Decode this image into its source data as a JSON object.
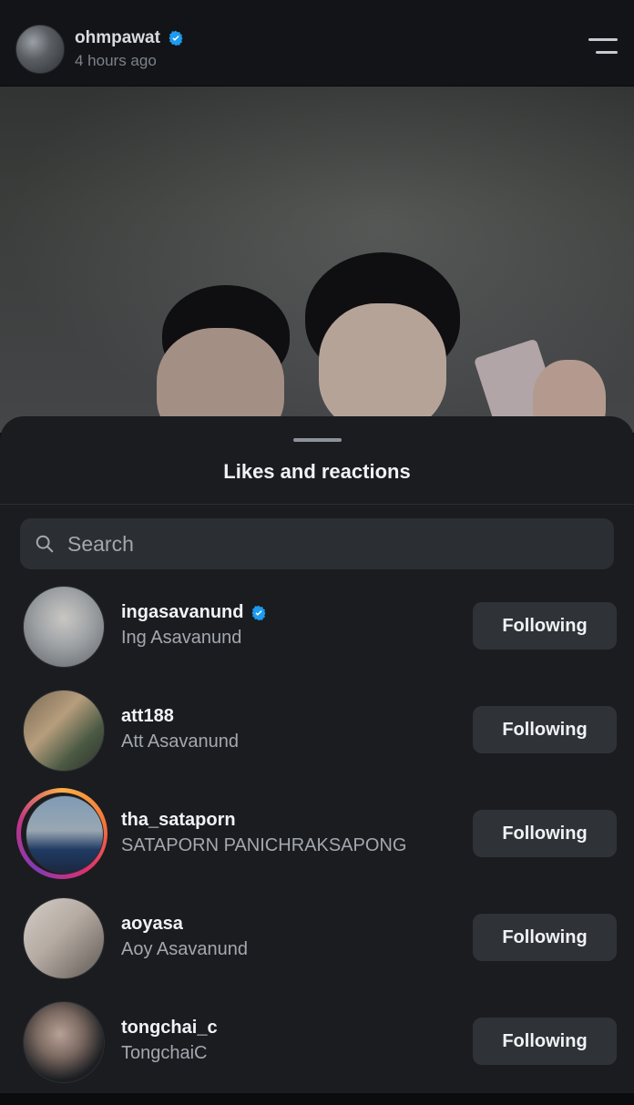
{
  "header": {
    "username": "ohmpawat",
    "time": "4 hours ago"
  },
  "sheet": {
    "title": "Likes and reactions",
    "search_placeholder": "Search"
  },
  "users": [
    {
      "username": "ingasavanund",
      "name": "Ing Asavanund",
      "verified": true,
      "story_ring": false,
      "button": "Following"
    },
    {
      "username": "att188",
      "name": "Att Asavanund",
      "verified": false,
      "story_ring": false,
      "button": "Following"
    },
    {
      "username": "tha_sataporn",
      "name": "SATAPORN PANICHRAKSAPONG",
      "verified": false,
      "story_ring": true,
      "button": "Following"
    },
    {
      "username": "aoyasa",
      "name": "Aoy Asavanund",
      "verified": false,
      "story_ring": false,
      "button": "Following"
    },
    {
      "username": "tongchai_c",
      "name": "TongchaiC",
      "verified": false,
      "story_ring": false,
      "button": "Following"
    }
  ],
  "colors": {
    "verified": "#1d9bf0",
    "button_bg": "#2f3237",
    "sheet_bg": "#1a1c20"
  },
  "icons": {
    "header_menu": "menu-icon",
    "search": "search-icon",
    "verified": "verified-badge-icon"
  }
}
